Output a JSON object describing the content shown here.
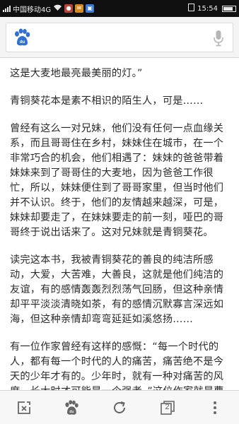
{
  "status_bar": {
    "carrier": "中国移动4G",
    "time": "15:54",
    "badges": {
      "wifi": "wifi-icon",
      "app1": "app-notification-icon",
      "app2": "app-notification-icon"
    }
  },
  "search": {
    "logo": "baidu-paw-logo",
    "mic": "microphone-icon"
  },
  "article": {
    "paragraphs": [
      "这是大麦地最亮最美丽的灯。”",
      "青铜葵花本是素不相识的陌生人，可是……",
      "曾经有这么一对兄妹，他们没有任何一点血缘关系，而且哥哥住在乡村，妹妹住在城市，在一个非常巧合的机会，他们相遇了：妹妹的爸爸带着妹妹来到了哥哥住的大麦地，因为爸爸工作很忙，所以，妹妹便住到了哥哥家里，但当时他们并不认识。终于，他们的友情越来越深，可是，妹妹却要走了，在妹妹要走的前一刻，哑巴的哥哥终于说出话来了。这对兄妹就是青铜葵花。",
      "读完这本书，我被青铜葵花的善良的纯洁所感动，大爱，大苦难，大善良，这就是他们纯洁的友谊，有的感情轰轰烈烈荡气回肠，但这种亲情却平平淡淡清晓如茶，有的感情沉默寡言深远如海，但这种亲情却弯弯延延如溪悠扬……",
      "有一位作家曾经有这样的感慨：“每一个时代的人，都有每一个时代的人的痛苦，痛苦绝不是今天的少年才有的。少年时，就有一种对痛苦的风度。长大时才可能是一个强者。”这位作家就是曹文轩，他也是青铜葵花，这对感人的兄妹的缔造者。"
    ]
  },
  "bottom_bar": {
    "tab_count": "2",
    "icons": [
      "exit-icon",
      "baidu-paw-icon",
      "refresh-icon",
      "tabs-icon",
      "more-icon"
    ]
  },
  "colors": {
    "baidu_blue": "#2f6fd6",
    "status_bg": "#0f0f0f",
    "text": "#2a2a2a"
  }
}
